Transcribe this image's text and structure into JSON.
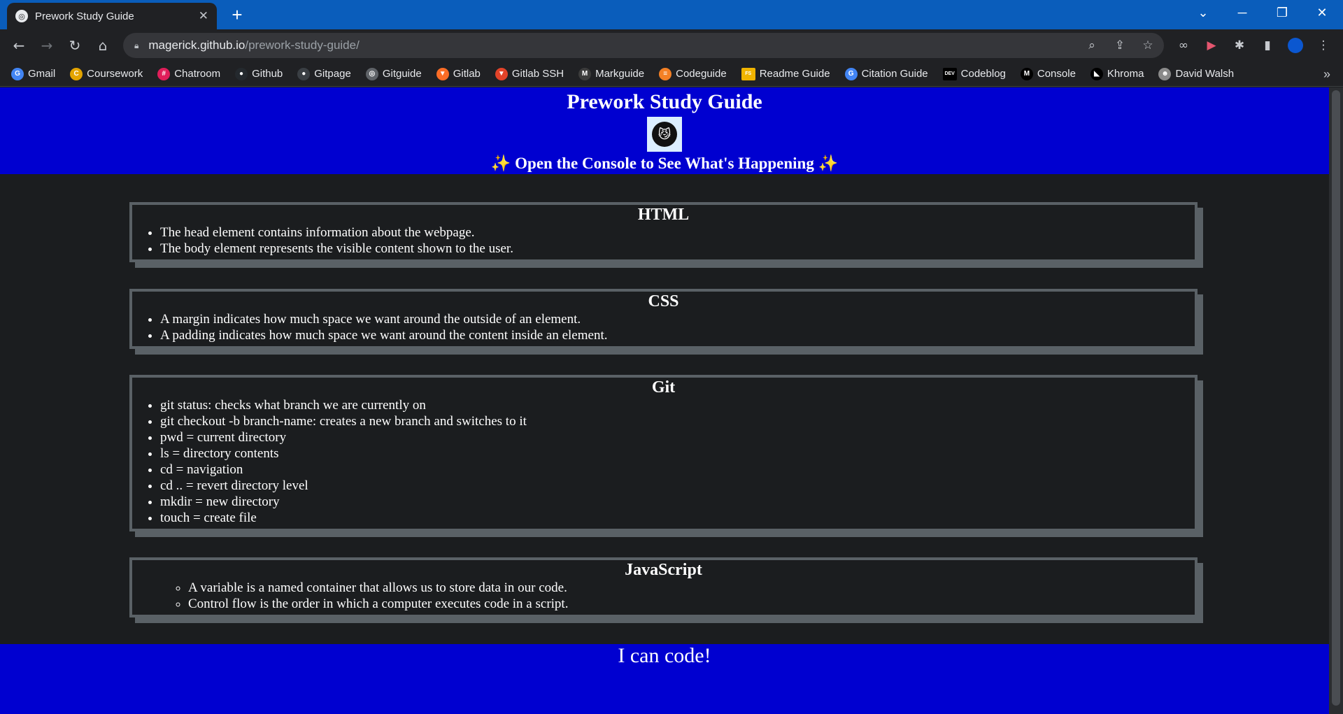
{
  "browser": {
    "tab_title": "Prework Study Guide",
    "tab_favicon": "globe-icon",
    "url_host": "magerick.github.io",
    "url_path": "/prework-study-guide/"
  },
  "bookmarks": [
    {
      "label": "Gmail",
      "icon": "google-icon",
      "color": "#4285f4",
      "glyph": "G"
    },
    {
      "label": "Coursework",
      "icon": "coursework-icon",
      "color": "#e3a400",
      "glyph": "C"
    },
    {
      "label": "Chatroom",
      "icon": "slack-icon",
      "color": "#e01e5a",
      "glyph": "#"
    },
    {
      "label": "Github",
      "icon": "github-icon",
      "color": "#24292e",
      "glyph": "●"
    },
    {
      "label": "Gitpage",
      "icon": "github-icon",
      "color": "#3a3f44",
      "glyph": "●"
    },
    {
      "label": "Gitguide",
      "icon": "globe-icon",
      "color": "#5f6368",
      "glyph": "◎"
    },
    {
      "label": "Gitlab",
      "icon": "gitlab-icon",
      "color": "#fc6d26",
      "glyph": "▼"
    },
    {
      "label": "Gitlab SSH",
      "icon": "gitlab-icon",
      "color": "#e24329",
      "glyph": "▼"
    },
    {
      "label": "Markguide",
      "icon": "markdown-icon",
      "color": "#3c3c3c",
      "glyph": "M"
    },
    {
      "label": "Codeguide",
      "icon": "stackoverflow-icon",
      "color": "#f48024",
      "glyph": "≡"
    },
    {
      "label": "Readme Guide",
      "icon": "fs-icon",
      "color": "#f0b400",
      "glyph": "FS"
    },
    {
      "label": "Citation Guide",
      "icon": "google-icon",
      "color": "#4285f4",
      "glyph": "G"
    },
    {
      "label": "Codeblog",
      "icon": "dev-icon",
      "color": "#000000",
      "glyph": "DEV"
    },
    {
      "label": "Console",
      "icon": "console-icon",
      "color": "#000000",
      "glyph": "M"
    },
    {
      "label": "Khroma",
      "icon": "khroma-icon",
      "color": "#000000",
      "glyph": "◣"
    },
    {
      "label": "David Walsh",
      "icon": "davidwalsh-icon",
      "color": "#8a8a8a",
      "glyph": "☻"
    }
  ],
  "page": {
    "title": "Prework Study Guide",
    "subtitle": "✨ Open the Console to See What's Happening ✨",
    "footer": "I can code!",
    "sections": [
      {
        "heading": "HTML",
        "items": [
          "The head element contains information about the webpage.",
          "The body element represents the visible content shown to the user."
        ]
      },
      {
        "heading": "CSS",
        "items": [
          "A margin indicates how much space we want around the outside of an element.",
          "A padding indicates how much space we want around the content inside an element."
        ]
      },
      {
        "heading": "Git",
        "items": [
          "git status: checks what branch we are currently on",
          "git checkout -b branch-name: creates a new branch and switches to it",
          "pwd = current directory",
          "ls = directory contents",
          "cd = navigation",
          "cd .. = revert directory level",
          "mkdir = new directory",
          "touch = create file"
        ]
      },
      {
        "heading": "JavaScript",
        "items": [
          "A variable is a named container that allows us to store data in our code.",
          "Control flow is the order in which a computer executes code in a script."
        ]
      }
    ]
  },
  "colors": {
    "header_bg": "#0000d0",
    "page_bg": "#1b1d1f",
    "card_border": "#5a6166",
    "browser_titlebar": "#0a5dbb"
  }
}
